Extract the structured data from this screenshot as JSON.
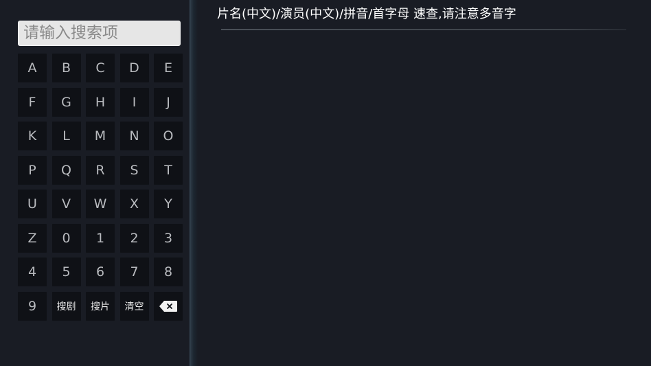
{
  "search": {
    "placeholder": "请输入搜索项",
    "value": ""
  },
  "keyboard": {
    "keys": [
      {
        "label": "A"
      },
      {
        "label": "B"
      },
      {
        "label": "C"
      },
      {
        "label": "D"
      },
      {
        "label": "E"
      },
      {
        "label": "F"
      },
      {
        "label": "G"
      },
      {
        "label": "H"
      },
      {
        "label": "I"
      },
      {
        "label": "J"
      },
      {
        "label": "K"
      },
      {
        "label": "L"
      },
      {
        "label": "M"
      },
      {
        "label": "N"
      },
      {
        "label": "O"
      },
      {
        "label": "P"
      },
      {
        "label": "Q"
      },
      {
        "label": "R"
      },
      {
        "label": "S"
      },
      {
        "label": "T"
      },
      {
        "label": "U"
      },
      {
        "label": "V"
      },
      {
        "label": "W"
      },
      {
        "label": "X"
      },
      {
        "label": "Y"
      },
      {
        "label": "Z"
      },
      {
        "label": "0"
      },
      {
        "label": "1"
      },
      {
        "label": "2"
      },
      {
        "label": "3"
      },
      {
        "label": "4"
      },
      {
        "label": "5"
      },
      {
        "label": "6"
      },
      {
        "label": "7"
      },
      {
        "label": "8"
      },
      {
        "label": "9"
      },
      {
        "label": "搜剧"
      },
      {
        "label": "搜片"
      },
      {
        "label": "清空"
      }
    ],
    "backspace_icon": "backspace-icon"
  },
  "hint": {
    "text": "片名(中文)/演员(中文)/拼音/首字母 速查,请注意多音字"
  },
  "colors": {
    "background": "#191c24",
    "key_background": "#0f1116",
    "key_text": "#b9bbbf",
    "search_box_background": "#e6e6e6",
    "hint_text": "#ffffff",
    "divider_accent": "#3c4d5c"
  }
}
